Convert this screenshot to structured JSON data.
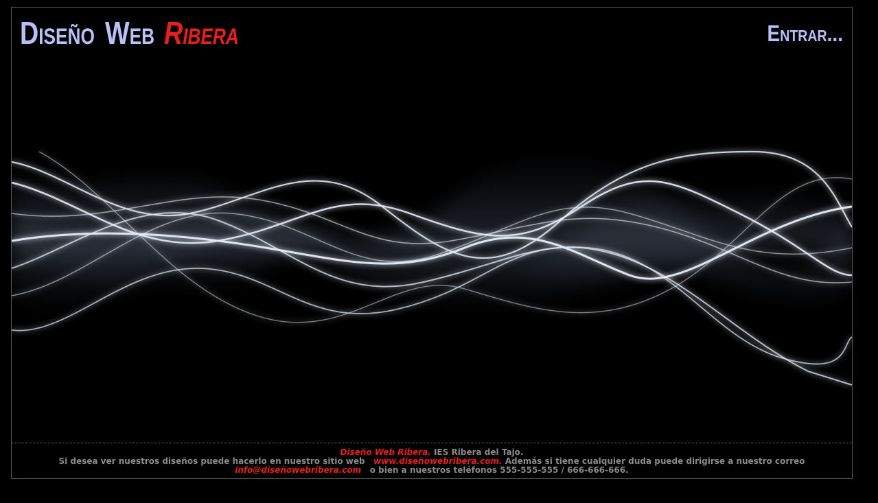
{
  "header": {
    "logo": {
      "part1": "Diseño",
      "part2": "Web",
      "part3": "Ribera"
    },
    "enter_label": "Entrar..."
  },
  "hero": {
    "image_name": "abstract-smoke-waves-image"
  },
  "footer": {
    "line1": {
      "brand": "Diseño Web Ribera.",
      "text": " IES Ribera del Tajo."
    },
    "line2": {
      "text_before": "Si desea ver nuestros diseños puede hacerlo en nuestro sitio web",
      "website": "www.diseñowebribera.com.",
      "text_after": " Además si tiene cualquier duda puede dirigirse a nuestro correo"
    },
    "line3": {
      "email": "info@diseñowebribera.com",
      "text_after": "o bien a nuestros teléfonos 555-555-555 / 666-666-666."
    }
  },
  "colors": {
    "background": "#000000",
    "logo_light": "#b8c0f5",
    "accent_red": "#e8201c",
    "footer_text": "#8a8a8a"
  }
}
